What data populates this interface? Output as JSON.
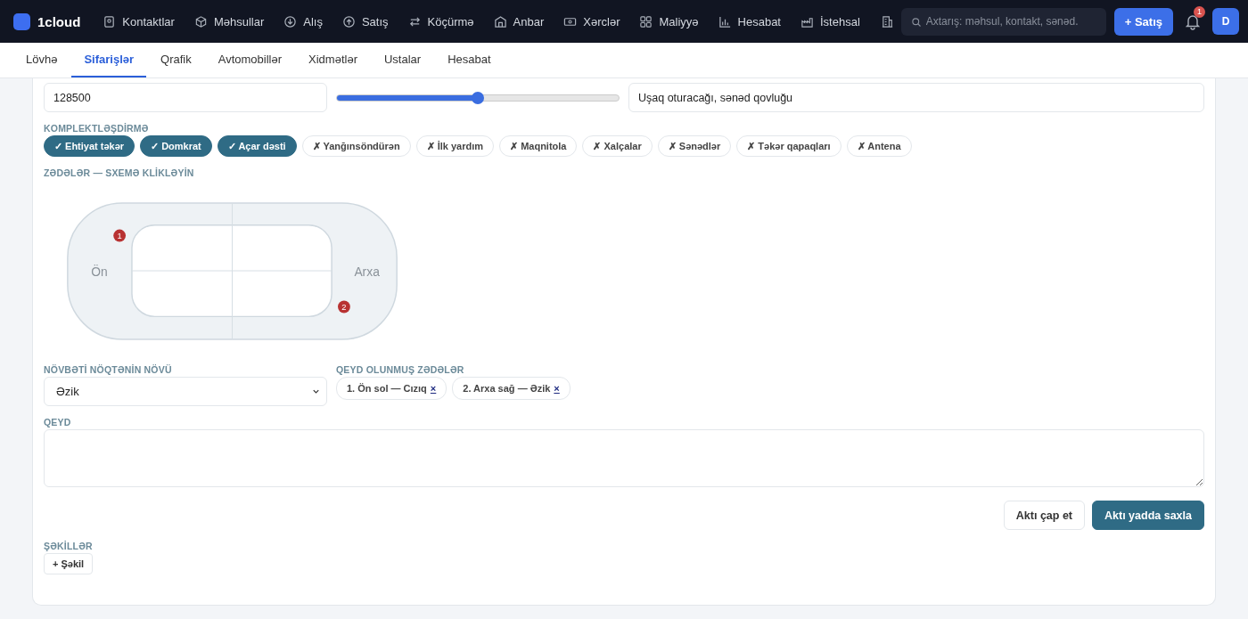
{
  "brand": {
    "name": "1cloud"
  },
  "nav": [
    {
      "label": "Kontaktlar"
    },
    {
      "label": "Məhsullar"
    },
    {
      "label": "Alış"
    },
    {
      "label": "Satış"
    },
    {
      "label": "Köçürmə"
    },
    {
      "label": "Anbar"
    },
    {
      "label": "Xərclər"
    },
    {
      "label": "Maliyyə"
    },
    {
      "label": "Hesabat"
    },
    {
      "label": "İstehsal"
    }
  ],
  "search": {
    "placeholder": "Axtarış: məhsul, kontakt, sənəd."
  },
  "new_sale_button": "+ Satış",
  "notifications": {
    "count": "1"
  },
  "avatar": "D",
  "tabs": [
    {
      "label": "Lövhə",
      "selected": false
    },
    {
      "label": "Sifarişlər",
      "selected": true
    },
    {
      "label": "Qrafik",
      "selected": false
    },
    {
      "label": "Avtomobillər",
      "selected": false
    },
    {
      "label": "Xidmətlər",
      "selected": false
    },
    {
      "label": "Ustalar",
      "selected": false
    },
    {
      "label": "Hesabat",
      "selected": false
    }
  ],
  "mileage": {
    "value": "128500"
  },
  "fuel": {
    "level": 0.5
  },
  "items_note": {
    "value": "Uşaq oturacağı, sənəd qovluğu"
  },
  "equipment": {
    "label": "KOMPLEKTLƏŞDİRMƏ",
    "items": [
      {
        "label": "✓ Ehtiyat təkər",
        "checked": true
      },
      {
        "label": "✓ Domkrat",
        "checked": true
      },
      {
        "label": "✓ Açar dəsti",
        "checked": true
      },
      {
        "label": "✗ Yanğınsöndürən",
        "checked": false
      },
      {
        "label": "✗ İlk yardım",
        "checked": false
      },
      {
        "label": "✗ Maqnitola",
        "checked": false
      },
      {
        "label": "✗ Xalçalar",
        "checked": false
      },
      {
        "label": "✗ Sənədlər",
        "checked": false
      },
      {
        "label": "✗ Təkər qapaqları",
        "checked": false
      },
      {
        "label": "✗ Antena",
        "checked": false
      }
    ]
  },
  "damage": {
    "label": "ZƏDƏLƏR — SXEMƏ KLİKLƏYİN",
    "front": "Ön",
    "rear": "Arxa",
    "markers": [
      {
        "number": "1"
      },
      {
        "number": "2"
      }
    ]
  },
  "point_type": {
    "label": "NÖVBƏTİ NÖQTƏNİN NÖVÜ",
    "value": "Əzik"
  },
  "recorded": {
    "label": "QEYD OLUNMUŞ ZƏDƏLƏR",
    "items": [
      {
        "text": "1. Ön sol — Cızıq",
        "remove": "×"
      },
      {
        "text": "2. Arxa sağ — Əzik",
        "remove": "×"
      }
    ]
  },
  "note": {
    "label": "QEYD"
  },
  "actions": {
    "print": "Aktı çap et",
    "save": "Aktı yadda saxla"
  },
  "photos": {
    "label": "ŞƏKİLLƏR",
    "add": "+ Şəkil"
  }
}
